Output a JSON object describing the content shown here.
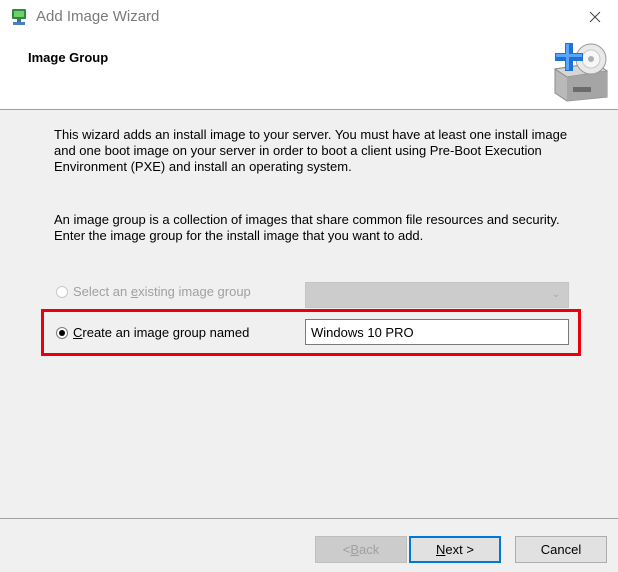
{
  "window": {
    "title": "Add Image Wizard"
  },
  "header": {
    "title": "Image Group"
  },
  "intro_text": "This wizard adds an install image to your server. You must have at least one install image and one boot image on your server in order to boot a client using Pre-Boot Execution Environment (PXE) and install an operating system.",
  "group_desc": "An image group is a collection of images that share common file resources and security. Enter the image group for the install image that you want to add.",
  "options": {
    "existing": {
      "label_pre": "Select an ",
      "label_key": "e",
      "label_post": "xisting image group",
      "selected": false,
      "enabled": false
    },
    "create": {
      "label_key": "C",
      "label_post": "reate an image group named",
      "selected": true,
      "enabled": true
    }
  },
  "existing_combo": {
    "value": ""
  },
  "group_name_input": {
    "value": "Windows 10 PRO"
  },
  "buttons": {
    "back": {
      "pre": "< ",
      "key": "B",
      "post": "ack"
    },
    "next": {
      "key": "N",
      "post": "ext >"
    },
    "cancel": {
      "label": "Cancel"
    }
  },
  "colors": {
    "highlight": "#e8000b",
    "accent": "#0078d7"
  }
}
